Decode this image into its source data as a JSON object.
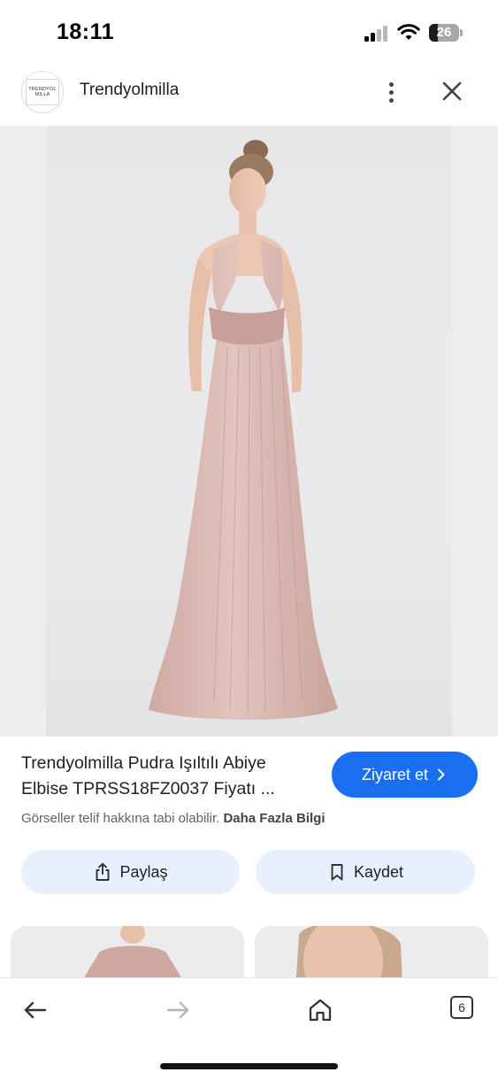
{
  "status_bar": {
    "time": "18:11",
    "battery_level": "26"
  },
  "header": {
    "site_name": "Trendyolmilla",
    "logo_line1": "TRENDYOL",
    "logo_line2": "MILLA"
  },
  "result": {
    "title": "Trendyolmilla Pudra Işıltılı Abiye Elbise TPRSS18FZ0037 Fiyatı ...",
    "visit_label": "Ziyaret et",
    "copyright_text": "Görseller telif hakkına tabi olabilir.",
    "more_info_label": "Daha Fazla Bilgi"
  },
  "actions": {
    "share_label": "Paylaş",
    "save_label": "Kaydet"
  },
  "bottom_nav": {
    "tab_count": "6"
  },
  "colors": {
    "accent": "#1a6ff0",
    "chip_bg": "#e8effd",
    "dress": "#d9b7b0"
  },
  "icons": [
    "signal-icon",
    "wifi-icon",
    "battery-icon",
    "more-vertical-icon",
    "close-icon",
    "chevron-right-icon",
    "share-icon",
    "bookmark-icon",
    "back-arrow-icon",
    "forward-arrow-icon",
    "home-icon",
    "tabs-icon"
  ]
}
